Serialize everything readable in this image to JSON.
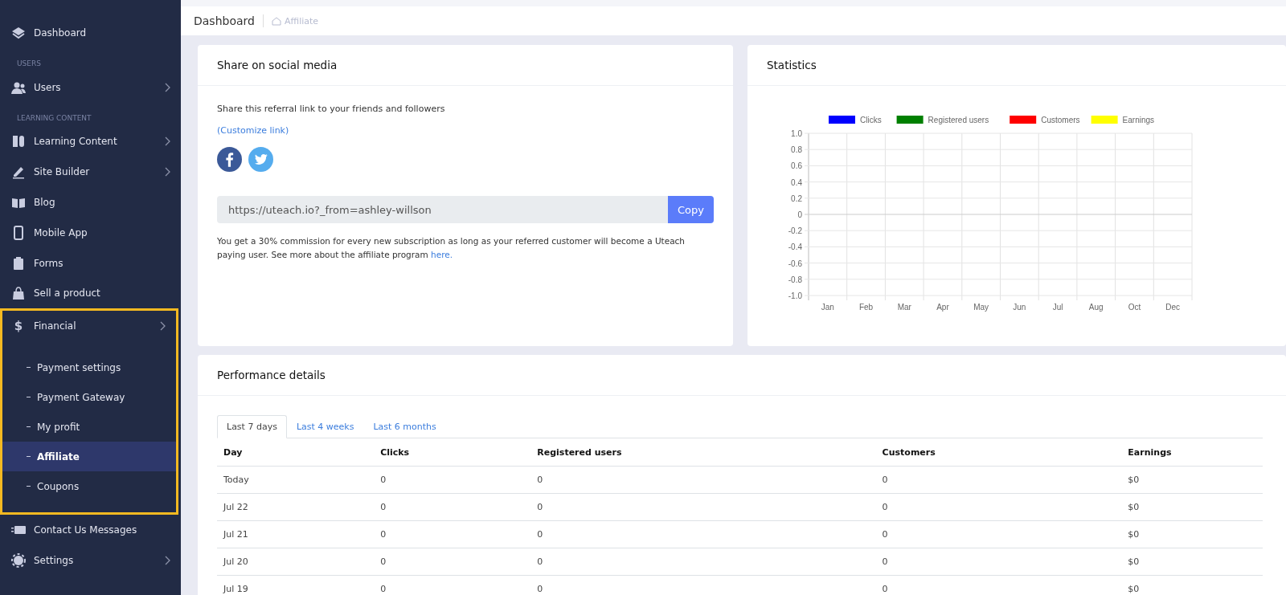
{
  "sidebar": {
    "items": [
      {
        "kind": "item",
        "label": "Dashboard",
        "arrow": false,
        "selected": false
      },
      {
        "kind": "section",
        "label": "USERS"
      },
      {
        "kind": "item",
        "label": "Users",
        "arrow": true,
        "selected": false
      },
      {
        "kind": "section",
        "label": "LEARNING CONTENT"
      },
      {
        "kind": "item",
        "label": "Learning Content",
        "arrow": true,
        "selected": false
      },
      {
        "kind": "item",
        "label": "Site Builder",
        "arrow": true,
        "selected": false
      },
      {
        "kind": "item",
        "label": "Blog",
        "arrow": false,
        "selected": false
      },
      {
        "kind": "item",
        "label": "Mobile App",
        "arrow": false,
        "selected": false
      },
      {
        "kind": "item",
        "label": "Forms",
        "arrow": false,
        "selected": false
      },
      {
        "kind": "item",
        "label": "Sell a product",
        "arrow": false,
        "selected": false
      },
      {
        "kind": "group",
        "label": "Financial",
        "icon_text": "$",
        "arrow": true,
        "highlighted": true,
        "expanded": true,
        "children": [
          {
            "label": "Payment settings",
            "selected": false
          },
          {
            "label": "Payment Gateway",
            "selected": false
          },
          {
            "label": "My profit",
            "selected": false
          },
          {
            "label": "Affiliate",
            "selected": true
          },
          {
            "label": "Coupons",
            "selected": false
          }
        ]
      },
      {
        "kind": "item",
        "label": "Contact Us Messages",
        "arrow": false,
        "selected": false
      },
      {
        "kind": "item",
        "label": "Settings",
        "arrow": true,
        "selected": false
      }
    ]
  },
  "breadcrumb": {
    "title": "Dashboard",
    "current": "Affiliate"
  },
  "share_card": {
    "title": "Share on social media",
    "intro": "Share this referral link to your friends and followers",
    "customize_link": "(Customize link)",
    "link_value": "https://uteach.io?_from=ashley-willson",
    "copy_button": "Copy",
    "note": "You get a 30% commission for every new subscription as long as your referred customer will become a Uteach paying user. See more about the affiliate program ",
    "note_link": "here."
  },
  "statistics_card": {
    "title": "Statistics",
    "chart_data": {
      "type": "line",
      "categories": [
        "Jan",
        "Feb",
        "Mar",
        "Apr",
        "May",
        "Jun",
        "Jul",
        "Aug",
        "Oct",
        "Dec"
      ],
      "series": [
        {
          "name": "Clicks",
          "color": "#0000ff",
          "values": [
            null,
            null,
            null,
            null,
            null,
            null,
            null,
            null,
            null,
            null
          ]
        },
        {
          "name": "Registered users",
          "color": "#008000",
          "values": [
            null,
            null,
            null,
            null,
            null,
            null,
            null,
            null,
            null,
            null
          ]
        },
        {
          "name": "Customers",
          "color": "#ff0000",
          "values": [
            null,
            null,
            null,
            null,
            null,
            null,
            null,
            null,
            null,
            null
          ]
        },
        {
          "name": "Earnings",
          "color": "#ffff00",
          "values": [
            null,
            null,
            null,
            null,
            null,
            null,
            null,
            null,
            null,
            null
          ]
        }
      ],
      "ylim": [
        -1,
        1
      ],
      "grid": true,
      "yticks": [
        {
          "value": 1,
          "label": "1.0"
        },
        {
          "value": 0.8,
          "label": "0.8"
        },
        {
          "value": 0.6,
          "label": "0.6"
        },
        {
          "value": 0.4,
          "label": "0.4"
        },
        {
          "value": 0.2,
          "label": "0.2"
        },
        {
          "value": 0,
          "label": "0"
        },
        {
          "value": -0.2,
          "label": "-0.2"
        },
        {
          "value": -0.4,
          "label": "-0.4"
        },
        {
          "value": -0.6,
          "label": "-0.6"
        },
        {
          "value": -0.8,
          "label": "-0.8"
        },
        {
          "value": -1,
          "label": "-1.0"
        }
      ]
    }
  },
  "performance_card": {
    "title": "Performance details",
    "tabs": [
      {
        "label": "Last 7 days",
        "selected": true
      },
      {
        "label": "Last 4 weeks",
        "selected": false
      },
      {
        "label": "Last 6 months",
        "selected": false
      }
    ],
    "table": {
      "columns": [
        "Day",
        "Clicks",
        "Registered users",
        "Customers",
        "Earnings"
      ],
      "rows": [
        [
          "Today",
          "0",
          "0",
          "0",
          "$0"
        ],
        [
          "Jul 22",
          "0",
          "0",
          "0",
          "$0"
        ],
        [
          "Jul 21",
          "0",
          "0",
          "0",
          "$0"
        ],
        [
          "Jul 20",
          "0",
          "0",
          "0",
          "$0"
        ],
        [
          "Jul 19",
          "0",
          "0",
          "0",
          "$0"
        ]
      ]
    }
  }
}
